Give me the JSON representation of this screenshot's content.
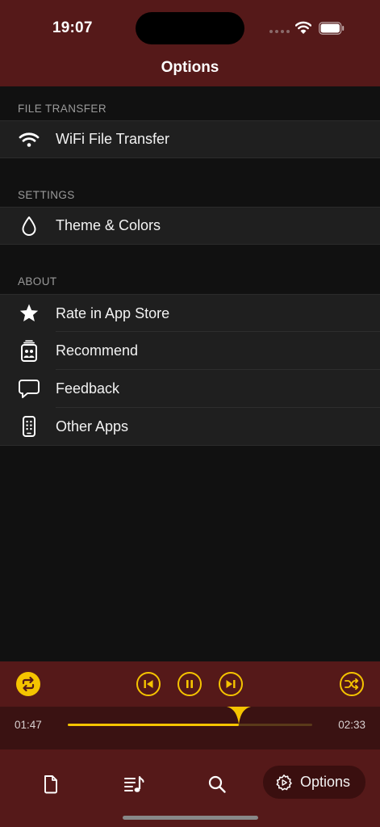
{
  "status_bar": {
    "time": "19:07"
  },
  "nav": {
    "title": "Options"
  },
  "sections": {
    "file_transfer": {
      "header": "FILE TRANSFER",
      "items": [
        {
          "label": "WiFi File Transfer",
          "icon": "wifi-icon"
        }
      ]
    },
    "settings": {
      "header": "SETTINGS",
      "items": [
        {
          "label": "Theme & Colors",
          "icon": "drop-icon"
        }
      ]
    },
    "about": {
      "header": "ABOUT",
      "items": [
        {
          "label": "Rate in App Store",
          "icon": "star-icon"
        },
        {
          "label": "Recommend",
          "icon": "share-app-icon"
        },
        {
          "label": "Feedback",
          "icon": "chat-bubble-icon"
        },
        {
          "label": "Other Apps",
          "icon": "phone-icon"
        }
      ]
    }
  },
  "player": {
    "elapsed": "01:47",
    "remaining": "02:33",
    "progress": 0.7,
    "controls": [
      "repeat-icon",
      "previous-track-icon",
      "pause-icon",
      "next-track-icon",
      "shuffle-icon"
    ]
  },
  "tab_bar": {
    "tabs": [
      {
        "icon": "file-icon"
      },
      {
        "icon": "playlist-icon"
      },
      {
        "icon": "search-icon"
      },
      {
        "icon": "gear-icon",
        "label": "Options",
        "selected": true
      }
    ]
  },
  "colors": {
    "accent": "#f5c400",
    "bar_background": "#551919",
    "list_background": "#1f1f1f",
    "page_background": "#111111"
  }
}
